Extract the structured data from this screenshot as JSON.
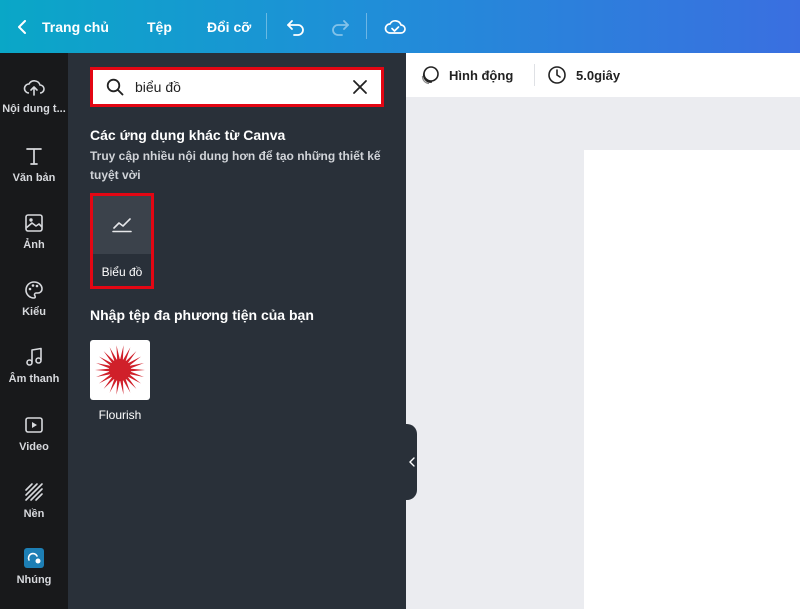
{
  "topbar": {
    "home_label": "Trang chủ",
    "file_label": "Tệp",
    "resize_label": "Đổi cỡ",
    "icons": [
      "chevron-left-icon",
      "undo-icon",
      "redo-icon",
      "cloud-check-icon"
    ]
  },
  "sidebar": {
    "items": [
      {
        "label": "Nội dung t...",
        "icon": "cloud-upload-icon"
      },
      {
        "label": "Văn bản",
        "icon": "text-icon"
      },
      {
        "label": "Ảnh",
        "icon": "image-icon"
      },
      {
        "label": "Kiểu",
        "icon": "palette-icon"
      },
      {
        "label": "Âm thanh",
        "icon": "music-icon"
      },
      {
        "label": "Video",
        "icon": "video-icon"
      },
      {
        "label": "Nền",
        "icon": "background-icon"
      },
      {
        "label": "Nhúng",
        "icon": "embed-icon"
      }
    ]
  },
  "panel": {
    "search": {
      "value": "biểu đồ"
    },
    "apps_section": {
      "title": "Các ứng dụng khác từ Canva",
      "subtitle": "Truy cập nhiều nội dung hơn để tạo những thiết kế tuyệt vời",
      "app_label": "Biểu đồ"
    },
    "media_section": {
      "title": "Nhập tệp đa phương tiện của bạn",
      "media_label": "Flourish"
    }
  },
  "editor_toolbar": {
    "animation_label": "Hình động",
    "duration_label": "5.0giây"
  },
  "colors": {
    "highlight": "#e30613",
    "panel_bg": "#293039",
    "rail_bg": "#18191b",
    "flourish_red": "#d0202a"
  }
}
